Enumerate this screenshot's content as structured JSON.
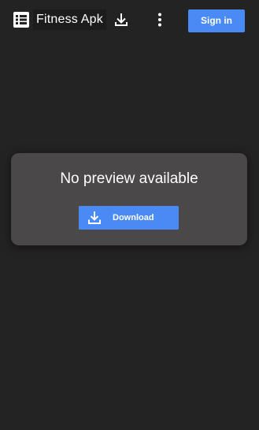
{
  "header": {
    "title": "Fitness Apk",
    "signin_label": "Sign in",
    "icons": [
      "document-icon",
      "download-icon",
      "more-vert-icon"
    ]
  },
  "preview": {
    "message": "No preview available",
    "download_label": "Download",
    "download_icon": "download-icon"
  },
  "colors": {
    "background": "#232323",
    "card": "#4a4848",
    "accent": "#4a8af4",
    "text": "#ffffff"
  }
}
